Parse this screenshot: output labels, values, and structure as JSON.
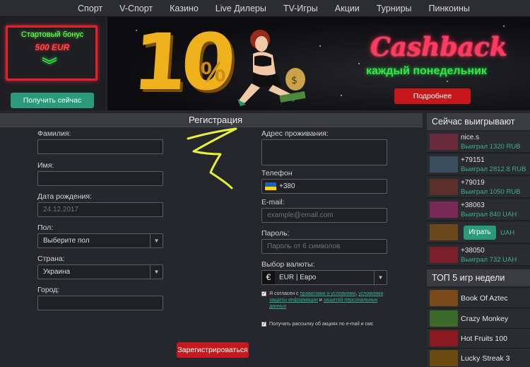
{
  "nav": [
    "Спорт",
    "V-Спорт",
    "Казино",
    "Live Дилеры",
    "TV-Игры",
    "Акции",
    "Турниры",
    "Пинкоины"
  ],
  "bonus": {
    "line1": "Стартовый бонус",
    "line2": "500 EUR",
    "button": "Получить сейчас"
  },
  "banner": {
    "big_number": "10",
    "percent": "%",
    "cashback": "Cashback",
    "weekly": "каждый понедельник",
    "more_button": "Подробнее"
  },
  "registration": {
    "title": "Регистрация",
    "last_name_label": "Фамилия:",
    "first_name_label": "Имя:",
    "birth_label": "Дата рождения:",
    "birth_placeholder": "24.12.2017",
    "gender_label": "Пол:",
    "gender_value": "Выберите пол",
    "country_label": "Страна:",
    "country_value": "Украина",
    "city_label": "Город:",
    "address_label": "Адрес проживания:",
    "phone_label": "Телефон",
    "phone_code": "+380",
    "email_label": "E-mail:",
    "email_placeholder": "example@email.com",
    "password_label": "Пароль:",
    "password_placeholder": "Пароль от 6 символов",
    "currency_label": "Выбор валюты:",
    "currency_value": "EUR | Евро",
    "terms_prefix": "Я согласен с",
    "terms_link1": "правилами и условиями",
    "terms_sep": ",",
    "terms_link2": "условиями защиты информации",
    "terms_and": "и",
    "terms_link3": "защитой персональных данных",
    "newsletter": "Получать рассылку об акциях по e-mail и смс",
    "submit": "Зарегистрироваться"
  },
  "winners": {
    "title": "Сейчас выигрывают",
    "rows": [
      {
        "name": "nice.s",
        "amount": "Выиграл 1320 RUB",
        "color": "#6a2c3c"
      },
      {
        "name": "+79151",
        "amount": "Выиграл 2812.8 RUB",
        "color": "#3a4d5e"
      },
      {
        "name": "+79019",
        "amount": "Выиграл 1050 RUB",
        "color": "#5a2f2a"
      },
      {
        "name": "+38063",
        "amount": "Выиграл 840 UAH",
        "color": "#7a2a58"
      },
      {
        "name": "",
        "amount": "UAH",
        "color": "#6a4a1c"
      },
      {
        "name": "+38050",
        "amount": "Выиграл 732 UAH",
        "color": "#7a1f2a"
      }
    ],
    "play_button": "Играть"
  },
  "top_games": {
    "title": "ТОП 5 игр недели",
    "items": [
      {
        "name": "Book Of Aztec",
        "color": "#7a4a1a"
      },
      {
        "name": "Crazy Monkey",
        "color": "#3c6a2a"
      },
      {
        "name": "Hot Fruits 100",
        "color": "#8a1a20"
      },
      {
        "name": "Lucky Streak 3",
        "color": "#6a4a10"
      }
    ]
  }
}
